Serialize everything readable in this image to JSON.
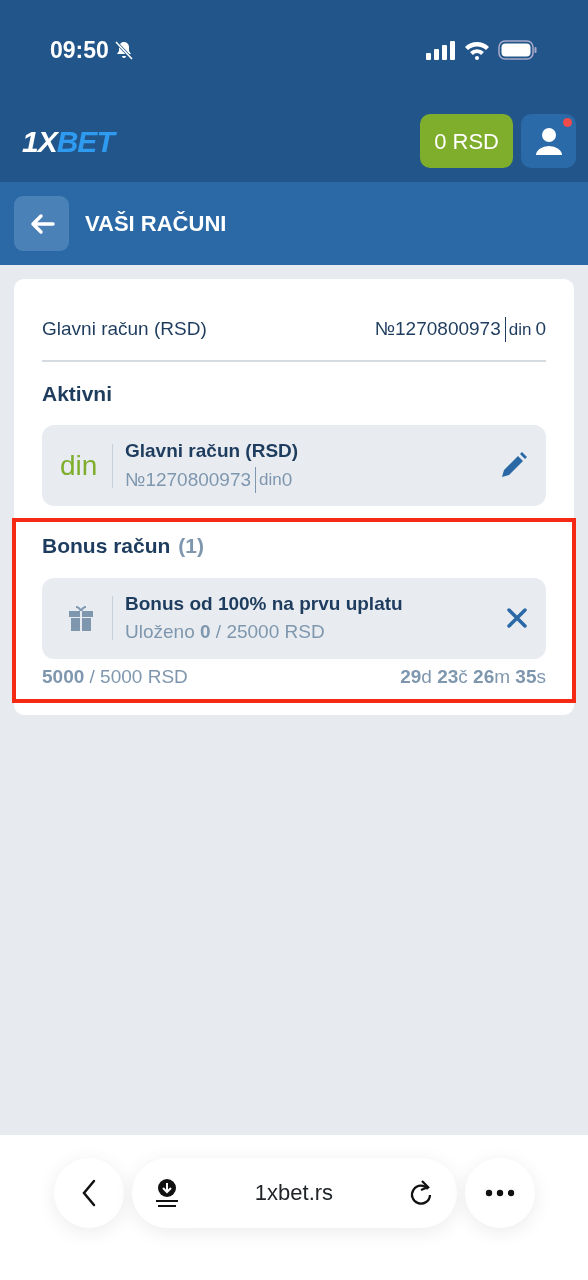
{
  "status_bar": {
    "time": "09:50",
    "muted": true
  },
  "header": {
    "logo": {
      "first": "1X",
      "second": "BET"
    },
    "balance": "0 RSD",
    "notification": true
  },
  "subheader": {
    "title": "VAŠI RAČUNI"
  },
  "main_account": {
    "label": "Glavni račun (RSD)",
    "number": "№1270800973",
    "currency": "din",
    "amount": "0"
  },
  "active": {
    "title": "Aktivni",
    "account": {
      "currency_logo": "din",
      "name": "Glavni račun (RSD)",
      "number": "№1270800973",
      "currency": "din",
      "amount": "0"
    }
  },
  "bonus": {
    "title": "Bonus račun",
    "count": "(1)",
    "highlighted": true,
    "item": {
      "name": "Bonus od 100% na prvu uplatu",
      "deposited": "Uloženo **0** / 25000 RSD"
    },
    "progress": "**5000** / 5000 RSD",
    "timer": "**29**d **23**č **26**m **35**s"
  },
  "browser": {
    "url": "1xbet.rs"
  }
}
